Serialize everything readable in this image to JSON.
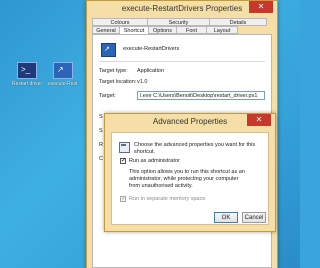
{
  "desktop": {
    "icons": [
      {
        "label": "Restart drivers",
        "icon": "powershell-icon"
      },
      {
        "label": "execute-Restart",
        "icon": "shortcut-icon"
      }
    ]
  },
  "properties_window": {
    "title": "execute-RestartDrivers Properties",
    "close_glyph": "✕",
    "tabs_row1": [
      "Colours",
      "Security",
      "Details"
    ],
    "tabs_row2": [
      "General",
      "Shortcut",
      "Options",
      "Font",
      "Layout"
    ],
    "active_tab": "Shortcut",
    "shortcut_name": "execute-RestartDrivers",
    "target_type_label": "Target type:",
    "target_type_value": "Application",
    "target_location_label": "Target location:",
    "target_location_value": "v1.0",
    "target_label": "Target:",
    "target_value": "l.exe C:\\Users\\Benoit\\Desktop\\restart_driver.ps1",
    "partial_labels": [
      "S",
      "S",
      "R",
      "C"
    ]
  },
  "advanced_dialog": {
    "title": "Advanced Properties",
    "close_glyph": "✕",
    "intro": "Choose the advanced properties you want for this shortcut.",
    "run_as_admin_label": "Run as administrator",
    "run_as_admin_checked": true,
    "description": "This option allows you to run this shortcut as an administrator, while protecting your computer from unauthorised activity.",
    "separate_memory_label": "Run in separate memory space",
    "separate_memory_checked": true,
    "ok_label": "OK",
    "cancel_label": "Cancel"
  },
  "colors": {
    "desktop_bg": "#3aa5dd",
    "window_frame": "#f5dfa6",
    "close_button": "#c7372b"
  }
}
